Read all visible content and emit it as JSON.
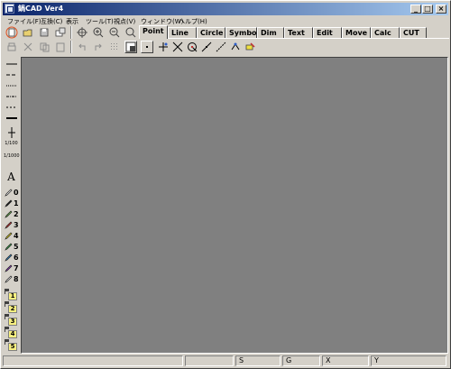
{
  "window": {
    "title": "鍋CAD Ver4",
    "minimize": "_",
    "maximize": "□",
    "close": "×"
  },
  "menu": [
    "ファイル(F)",
    "互換(C)",
    "表示",
    "ツール(T)",
    "視点(V)",
    "ウィンドウ(W)",
    "ヘルプ(H)"
  ],
  "tabs": [
    "Point",
    "Line",
    "Circle",
    "Symbol",
    "Dim",
    "Text",
    "Edit",
    "Move",
    "Calc",
    "CUT"
  ],
  "selected_tab": "Point",
  "toolbar": {
    "row1": [
      "new-icon",
      "open-icon",
      "save-icon",
      "print-setup-icon",
      "pan-icon",
      "zoom-in-icon",
      "zoom-out-icon",
      "zoom-fit-icon"
    ],
    "row2": [
      "print-icon",
      "cut-icon",
      "copy-icon",
      "paste-icon",
      "undo-icon",
      "redo-icon",
      "grid-icon",
      "layer-icon"
    ]
  },
  "point_tools": [
    "point-icon",
    "cross-point-icon",
    "intersection-icon",
    "circle-point-icon",
    "divide-point-icon",
    "line-point-icon",
    "end-point-icon",
    "delete-point-icon"
  ],
  "line_styles": [
    "solid",
    "dashed",
    "dotted",
    "dash-dot",
    "thick"
  ],
  "scale_labels": [
    "1/100",
    "1/1000"
  ],
  "text_tool": "A",
  "pens": [
    "0",
    "1",
    "2",
    "3",
    "4",
    "5",
    "6",
    "7",
    "8"
  ],
  "pen_colors": [
    "#ffffff",
    "#1a1a1a",
    "#6ab04c",
    "#d0312d",
    "#f0e020",
    "#3aa84a",
    "#2e88c8",
    "#8a3ab9",
    "#f0f0f0"
  ],
  "layers": [
    "1",
    "2",
    "3",
    "4",
    "5"
  ],
  "status": {
    "s": "S",
    "g": "G",
    "x": "X",
    "y": "Y"
  },
  "colors": {
    "canvas": "#808080",
    "title_start": "#0a246a",
    "title_end": "#a6caf0",
    "highlight": "#e05020"
  }
}
